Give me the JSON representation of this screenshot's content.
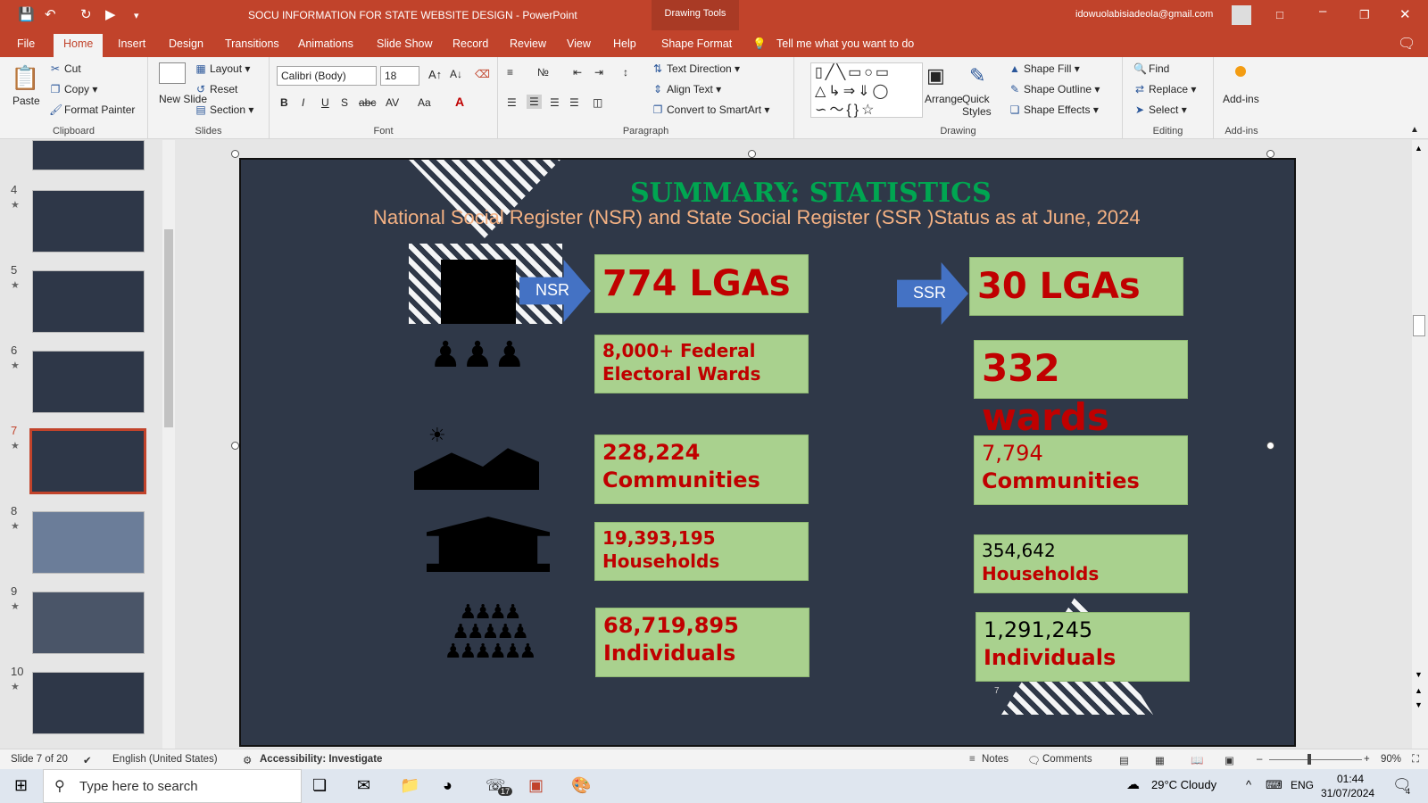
{
  "window": {
    "title": "SOCU INFORMATION FOR STATE WEBSITE DESIGN  -  PowerPoint",
    "context_tab": "Drawing Tools",
    "account_email": "idowuolabisiadeola@gmail.com"
  },
  "tabs": [
    "File",
    "Home",
    "Insert",
    "Design",
    "Transitions",
    "Animations",
    "Slide Show",
    "Record",
    "Review",
    "View",
    "Help",
    "Shape Format"
  ],
  "tell_me": "Tell me what you want to do",
  "ribbon": {
    "clipboard": {
      "label": "Clipboard",
      "paste": "Paste",
      "cut": "Cut",
      "copy": "Copy",
      "format_painter": "Format Painter"
    },
    "slides": {
      "label": "Slides",
      "new_slide": "New Slide",
      "layout": "Layout",
      "reset": "Reset",
      "section": "Section"
    },
    "font": {
      "label": "Font",
      "family": "Calibri (Body)",
      "size": "18"
    },
    "paragraph": {
      "label": "Paragraph",
      "text_direction": "Text Direction",
      "align_text": "Align Text",
      "convert_smartart": "Convert to SmartArt"
    },
    "drawing": {
      "label": "Drawing",
      "arrange": "Arrange",
      "quick_styles": "Quick Styles",
      "shape_fill": "Shape Fill",
      "shape_outline": "Shape Outline",
      "shape_effects": "Shape Effects"
    },
    "editing": {
      "label": "Editing",
      "find": "Find",
      "replace": "Replace",
      "select": "Select"
    },
    "addins": {
      "label": "Add-ins",
      "button": "Add-ins"
    }
  },
  "thumbnails": [
    {
      "num": "",
      "star": ""
    },
    {
      "num": "4",
      "star": "★"
    },
    {
      "num": "5",
      "star": "★"
    },
    {
      "num": "6",
      "star": "★"
    },
    {
      "num": "7",
      "star": "★"
    },
    {
      "num": "8",
      "star": "★"
    },
    {
      "num": "9",
      "star": "★"
    },
    {
      "num": "10",
      "star": "★"
    }
  ],
  "slide": {
    "title": "SUMMARY: STATISTICS",
    "subtitle": "National Social Register (NSR) and State Social Register (SSR )Status as at June, 2024",
    "nsr_arrow": "NSR",
    "ssr_arrow": "SSR",
    "nsr": {
      "lgas": "774 LGAs",
      "wards": "8,000+ Federal Electoral Wards",
      "communities": "228,224 Communities",
      "households": "19,393,195 Households",
      "individuals": "68,719,895 Individuals"
    },
    "ssr": {
      "lgas": "30 LGAs",
      "wards": "332 wards",
      "communities_num": "7,794",
      "communities_label": "Communities",
      "households_num": "354,642",
      "households_label": "Households",
      "individuals_num": "1,291,245",
      "individuals_label": "Individuals"
    },
    "page_number": "7"
  },
  "status": {
    "slide_of": "Slide 7 of 20",
    "language": "English (United States)",
    "accessibility": "Accessibility: Investigate",
    "notes": "Notes",
    "comments": "Comments",
    "zoom": "90%"
  },
  "taskbar": {
    "search_placeholder": "Type here to search",
    "weather": "29°C  Cloudy",
    "lang": "ENG",
    "time": "01:44",
    "date": "31/07/2024",
    "whatsapp_badge": "17",
    "notif_count": "4"
  },
  "colors": {
    "accent": "#c1432b",
    "slide_bg": "#2f3848",
    "box_green": "#a9d18e",
    "box_text_red": "#c00000",
    "title_green": "#00a651",
    "subtitle_orange": "#f4b183",
    "arrow_blue": "#4472c4"
  }
}
